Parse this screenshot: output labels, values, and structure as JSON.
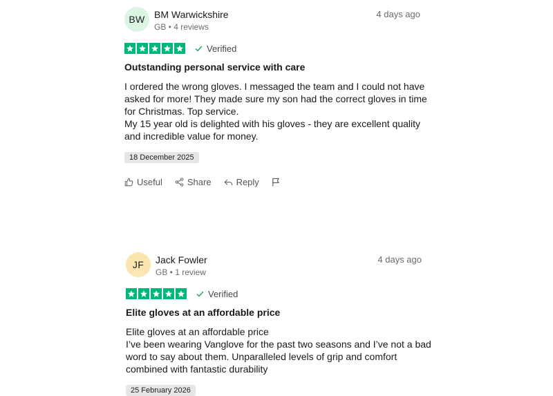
{
  "reviews": [
    {
      "initials": "BW",
      "avatar_color": "#dcf5e3",
      "name": "BM Warwickshire",
      "meta": "GB • 4 reviews",
      "date_ago": "4 days ago",
      "rating": 5,
      "verified": "Verified",
      "title": "Outstanding personal service with care",
      "body_lines": [
        "I ordered the wrong gloves. I messaged the team and I could not have",
        "asked for more! They made sure my son had the correct gloves in time",
        "for Christmas. Top service.",
        "My 15 year old is delighted with his gloves - they are excellent quality",
        "and incredible value for money."
      ],
      "experience_date": "18 December 2025",
      "actions": {
        "useful": "Useful",
        "share": "Share",
        "reply": "Reply"
      }
    },
    {
      "initials": "JF",
      "avatar_color": "#fbe5b0",
      "name": "Jack Fowler",
      "meta": "GB • 1 review",
      "date_ago": "4 days ago",
      "rating": 5,
      "verified": "Verified",
      "title": "Elite gloves at an affordable price",
      "body_lines": [
        "Elite gloves at an affordable price",
        "I’ve been wearing Vanglove for the past two seasons and I’ve not a bad",
        "word to say about them. Unparalleled levels of grip and comfort",
        "combined with fantastic durability"
      ],
      "experience_date": "25 February 2026"
    }
  ],
  "colors": {
    "star_green": "#00b67a",
    "verified_check": "#1f9d55"
  },
  "icons": [
    "star-icon",
    "check-icon",
    "thumbs-up-icon",
    "share-icon",
    "reply-icon",
    "flag-icon"
  ]
}
